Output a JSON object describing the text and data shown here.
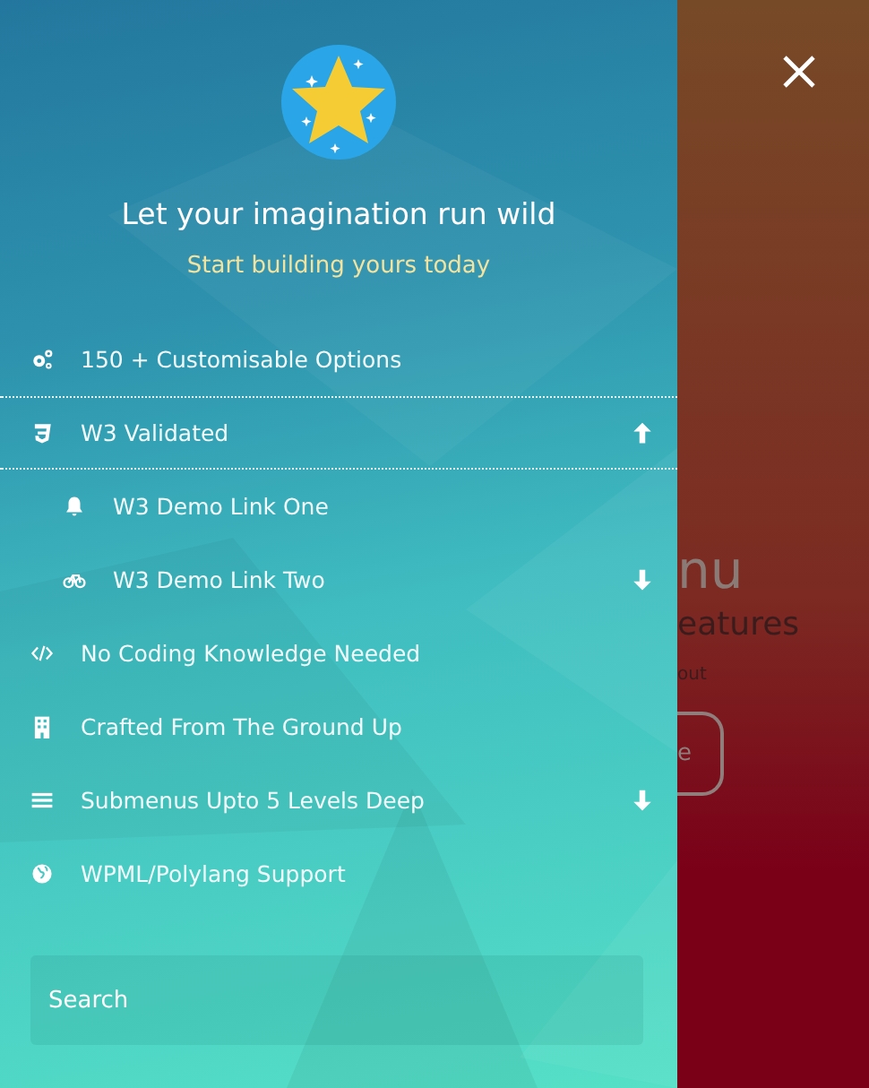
{
  "menu_header": {
    "title": "Let your imagination run wild",
    "subtitle": "Start building yours today"
  },
  "menu_items": [
    {
      "label": "150 + Customisable Options"
    },
    {
      "label": "W3 Validated",
      "expanded": true,
      "children": [
        {
          "label": "W3 Demo Link One"
        },
        {
          "label": "W3 Demo Link Two",
          "expanded": false
        }
      ]
    },
    {
      "label": "No Coding Knowledge Needed"
    },
    {
      "label": "Crafted From The Ground Up"
    },
    {
      "label": "Submenus Upto 5 Levels Deep",
      "expanded": false
    },
    {
      "label": "WPML/Polylang Support"
    }
  ],
  "search": {
    "placeholder": "Search"
  },
  "background_page": {
    "heading": "nu",
    "subheading": "eatures",
    "text": "out",
    "button": "e"
  }
}
